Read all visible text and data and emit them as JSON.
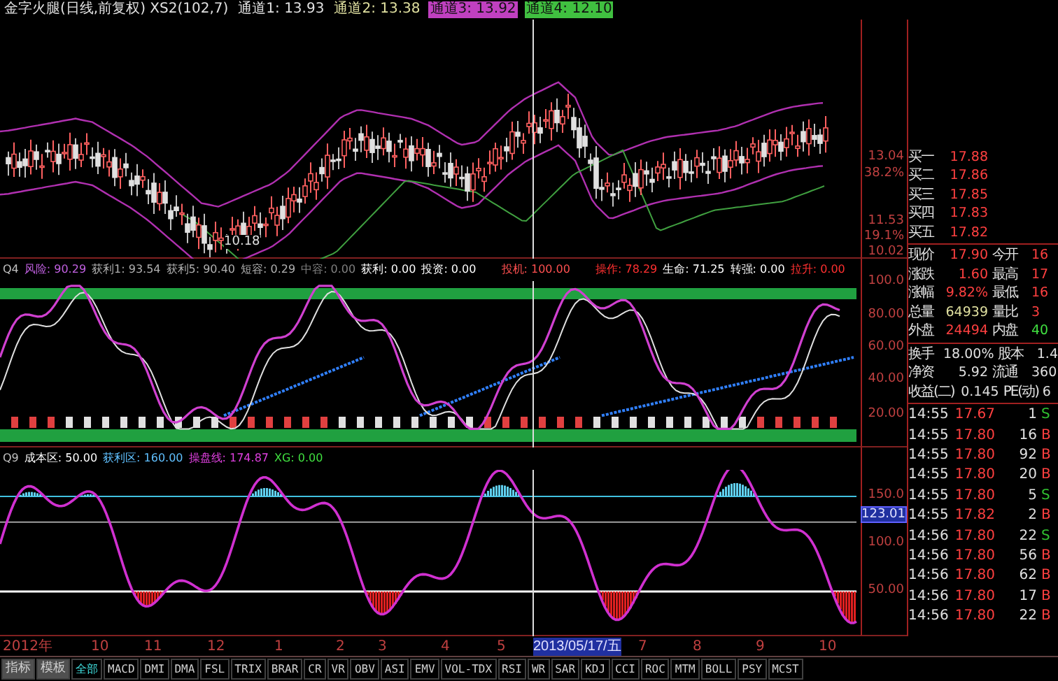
{
  "header": {
    "items": [
      {
        "text": "金字火腿(日线,前复权) XS2(102,7)",
        "color": "#e0e0e0",
        "boxed": false
      },
      {
        "text": "通道1: 13.93",
        "color": "#e0e0e0",
        "boxed": false
      },
      {
        "text": "通道2: 13.38",
        "color": "#e0e0a0",
        "boxed": false
      },
      {
        "text": "通道3: 13.92",
        "color": "#c040c0",
        "boxed": true
      },
      {
        "text": "通道4: 12.10",
        "color": "#40c040",
        "boxed": true
      }
    ]
  },
  "price_chart": {
    "low_label": "10.18",
    "axis_labels": [
      "13.04",
      "38.2%",
      "11.53",
      "19.1%",
      "10.02"
    ]
  },
  "indicator_1": {
    "name": "Q4",
    "items": [
      {
        "text": "风险: 90.29",
        "color": "#c060e0"
      },
      {
        "text": "获利1: 93.54",
        "color": "#b0b0b0"
      },
      {
        "text": "获利5: 90.40",
        "color": "#b0b0b0"
      },
      {
        "text": "短容: 0.29",
        "color": "#b0b0b0"
      },
      {
        "text": "中容: 0.00",
        "color": "#808080"
      },
      {
        "text": "获利: 0.00",
        "color": "#ffffff"
      },
      {
        "text": "投资: 0.00",
        "color": "#ffffff"
      },
      {
        "text": "投机: 100.00",
        "color": "#ff5050"
      },
      {
        "text": "操作: 78.29",
        "color": "#ff3030"
      },
      {
        "text": "生命: 71.25",
        "color": "#ffffff"
      },
      {
        "text": "转强: 0.00",
        "color": "#ffffff"
      },
      {
        "text": "拉升: 0.00",
        "color": "#ff3030"
      }
    ],
    "axis_labels": [
      "100.0",
      "80.00",
      "60.00",
      "40.00",
      "20.00"
    ]
  },
  "indicator_2": {
    "name": "Q9",
    "items": [
      {
        "text": "成本区: 50.00",
        "color": "#ffffff"
      },
      {
        "text": "获利区: 160.00",
        "color": "#60c0ff"
      },
      {
        "text": "操盘线: 174.87",
        "color": "#e040e0"
      },
      {
        "text": "XG: 0.00",
        "color": "#40e040"
      }
    ],
    "axis_labels": [
      "150.0",
      "123.01",
      "100.0",
      "50.00"
    ]
  },
  "quote": {
    "bids": [
      {
        "label": "买一",
        "price": "17.88"
      },
      {
        "label": "买二",
        "price": "17.86"
      },
      {
        "label": "买三",
        "price": "17.85"
      },
      {
        "label": "买四",
        "price": "17.83"
      },
      {
        "label": "买五",
        "price": "17.82"
      }
    ],
    "stats": [
      {
        "left": {
          "label": "现价",
          "value": "17.90",
          "color": "#ff4040"
        },
        "right": {
          "label": "今开",
          "value": "16",
          "color": "#ff4040"
        }
      },
      {
        "left": {
          "label": "涨跌",
          "value": "1.60",
          "color": "#ff4040"
        },
        "right": {
          "label": "最高",
          "value": "17",
          "color": "#ff4040"
        }
      },
      {
        "left": {
          "label": "涨幅",
          "value": "9.82%",
          "color": "#ff4040"
        },
        "right": {
          "label": "最低",
          "value": "16",
          "color": "#ff4040"
        }
      },
      {
        "left": {
          "label": "总量",
          "value": "64939",
          "color": "#e0e0a0"
        },
        "right": {
          "label": "量比",
          "value": "3",
          "color": "#ff4040"
        }
      },
      {
        "left": {
          "label": "外盘",
          "value": "24494",
          "color": "#ff4040"
        },
        "right": {
          "label": "内盘",
          "value": "40",
          "color": "#40e040"
        }
      },
      {
        "left": {
          "label": "换手",
          "value": "18.00%",
          "color": "#e0e0e0"
        },
        "right": {
          "label": "股本",
          "value": "1.4",
          "color": "#e0e0e0"
        }
      },
      {
        "left": {
          "label": "净资",
          "value": "5.92",
          "color": "#e0e0e0"
        },
        "right": {
          "label": "流通",
          "value": "360",
          "color": "#e0e0e0"
        }
      },
      {
        "left": {
          "label": "收益(二)",
          "value": "0.145",
          "color": "#e0e0e0"
        },
        "right": {
          "label": "PE(动)",
          "value": "6",
          "color": "#e0e0e0"
        }
      }
    ],
    "ticks": [
      {
        "time": "14:55",
        "price": "17.67",
        "volume": "1",
        "side": "S",
        "color": "#30c030"
      },
      {
        "time": "14:55",
        "price": "17.80",
        "volume": "16",
        "side": "B",
        "color": "#ff4040"
      },
      {
        "time": "14:55",
        "price": "17.80",
        "volume": "92",
        "side": "B",
        "color": "#ff4040"
      },
      {
        "time": "14:55",
        "price": "17.80",
        "volume": "20",
        "side": "B",
        "color": "#ff4040"
      },
      {
        "time": "14:55",
        "price": "17.80",
        "volume": "5",
        "side": "S",
        "color": "#30c030"
      },
      {
        "time": "14:55",
        "price": "17.82",
        "volume": "2",
        "side": "B",
        "color": "#ff4040"
      },
      {
        "time": "14:56",
        "price": "17.80",
        "volume": "22",
        "side": "S",
        "color": "#30c030"
      },
      {
        "time": "14:56",
        "price": "17.80",
        "volume": "56",
        "side": "B",
        "color": "#ff4040"
      },
      {
        "time": "14:56",
        "price": "17.80",
        "volume": "62",
        "side": "B",
        "color": "#ff4040"
      },
      {
        "time": "14:56",
        "price": "17.80",
        "volume": "17",
        "side": "B",
        "color": "#ff4040"
      },
      {
        "time": "14:56",
        "price": "17.80",
        "volume": "22",
        "side": "B",
        "color": "#ff4040"
      }
    ]
  },
  "date_axis": [
    {
      "label": "2012年",
      "selected": false
    },
    {
      "label": "10",
      "selected": false
    },
    {
      "label": "11",
      "selected": false
    },
    {
      "label": "12",
      "selected": false
    },
    {
      "label": "1",
      "selected": false
    },
    {
      "label": "2",
      "selected": false
    },
    {
      "label": "3",
      "selected": false
    },
    {
      "label": "4",
      "selected": false
    },
    {
      "label": "5",
      "selected": false
    },
    {
      "label": "2013/05/17/五",
      "selected": true
    },
    {
      "label": "7",
      "selected": false
    },
    {
      "label": "8",
      "selected": false
    },
    {
      "label": "9",
      "selected": false
    },
    {
      "label": "10",
      "selected": false
    }
  ],
  "tabs": [
    {
      "label": "指标",
      "kind": "button",
      "selected": false
    },
    {
      "label": "模板",
      "kind": "button",
      "selected": false
    },
    {
      "label": "全部",
      "kind": "tab",
      "selected": true
    },
    {
      "label": "MACD",
      "kind": "tab",
      "selected": false
    },
    {
      "label": "DMI",
      "kind": "tab",
      "selected": false
    },
    {
      "label": "DMA",
      "kind": "tab",
      "selected": false
    },
    {
      "label": "FSL",
      "kind": "tab",
      "selected": false
    },
    {
      "label": "TRIX",
      "kind": "tab",
      "selected": false
    },
    {
      "label": "BRAR",
      "kind": "tab",
      "selected": false
    },
    {
      "label": "CR",
      "kind": "tab",
      "selected": false
    },
    {
      "label": "VR",
      "kind": "tab",
      "selected": false
    },
    {
      "label": "OBV",
      "kind": "tab",
      "selected": false
    },
    {
      "label": "ASI",
      "kind": "tab",
      "selected": false
    },
    {
      "label": "EMV",
      "kind": "tab",
      "selected": false
    },
    {
      "label": "VOL-TDX",
      "kind": "tab",
      "selected": false
    },
    {
      "label": "RSI",
      "kind": "tab",
      "selected": false
    },
    {
      "label": "WR",
      "kind": "tab",
      "selected": false
    },
    {
      "label": "SAR",
      "kind": "tab",
      "selected": false
    },
    {
      "label": "KDJ",
      "kind": "tab",
      "selected": false
    },
    {
      "label": "CCI",
      "kind": "tab",
      "selected": false
    },
    {
      "label": "ROC",
      "kind": "tab",
      "selected": false
    },
    {
      "label": "MTM",
      "kind": "tab",
      "selected": false
    },
    {
      "label": "BOLL",
      "kind": "tab",
      "selected": false
    },
    {
      "label": "PSY",
      "kind": "tab",
      "selected": false
    },
    {
      "label": "MCST",
      "kind": "tab",
      "selected": false
    }
  ]
}
